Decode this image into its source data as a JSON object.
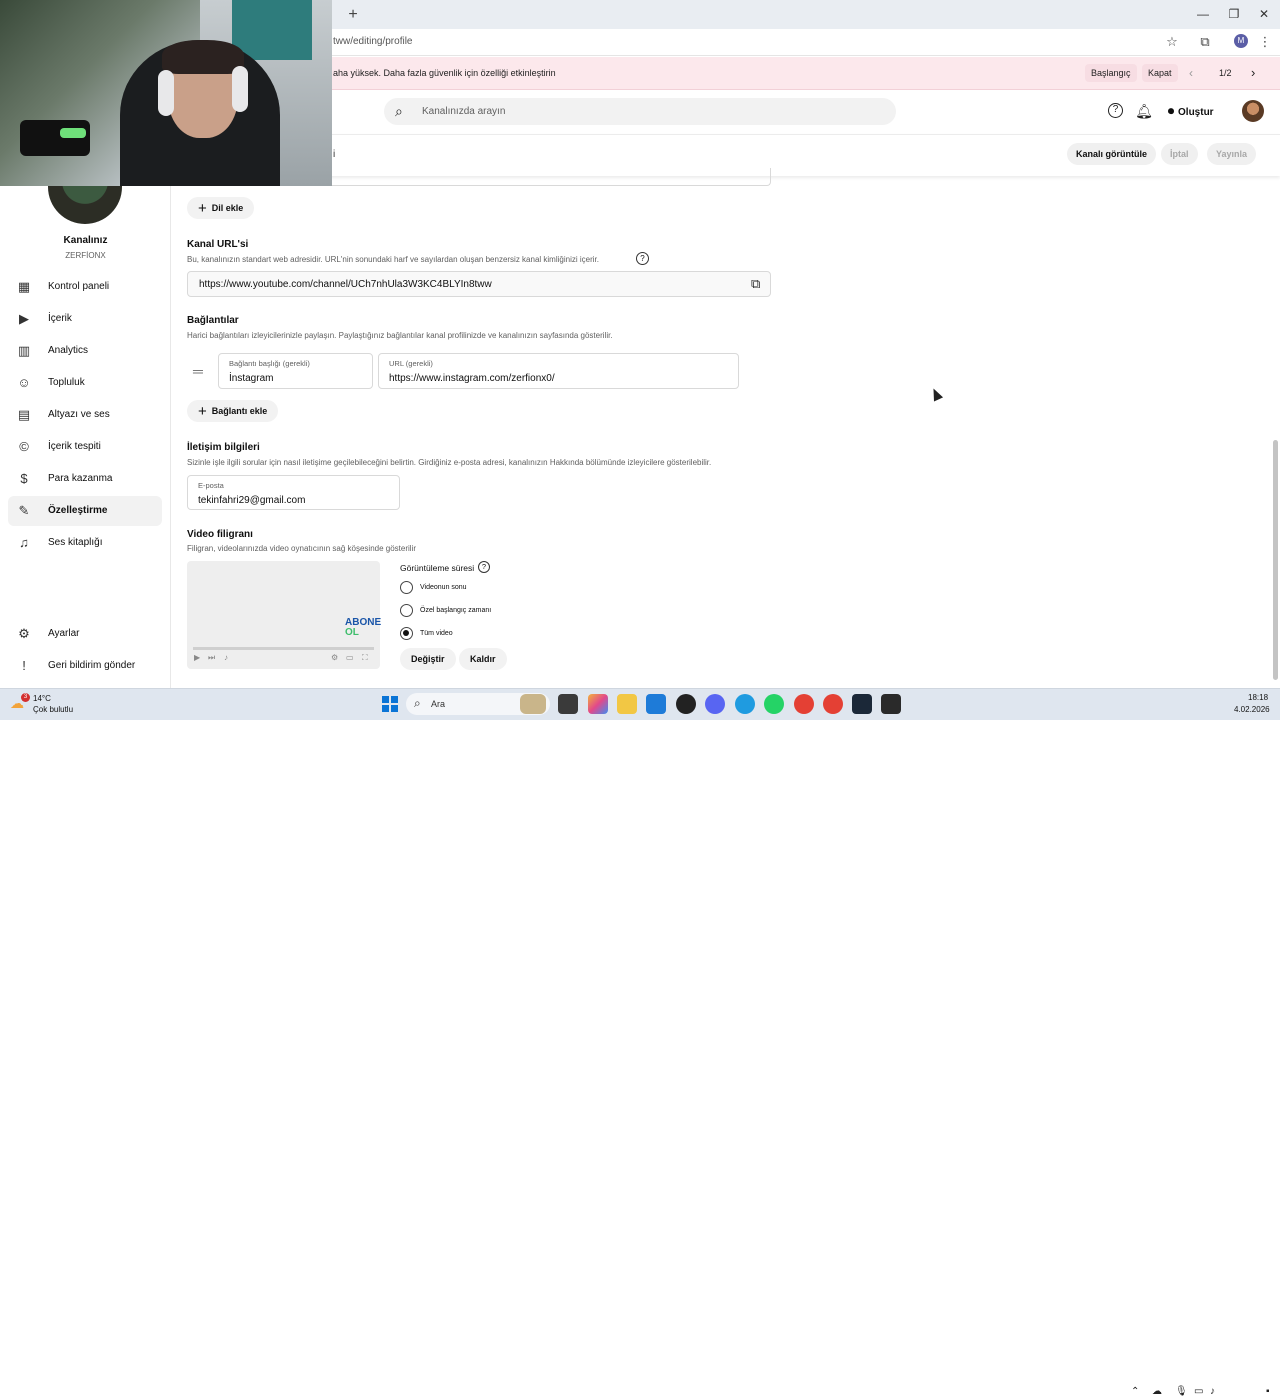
{
  "browser": {
    "url": "tww/editing/profile",
    "new_tab_label": "+",
    "window_controls": {
      "minimize": "—",
      "restore": "❐",
      "close": "✕"
    },
    "profile_initial": "M"
  },
  "infobar": {
    "text": "aha yüksek. Daha fazla güvenlik için özelliği etkinleştirin",
    "start_label": "Başlangıç",
    "close_label": "Kapat",
    "pager": "1/2"
  },
  "header": {
    "search_placeholder": "Kanalınızda arayın",
    "create_label": "Oluştur"
  },
  "subheader": {
    "partial_label": "i",
    "view_channel_label": "Kanalı görüntüle",
    "cancel_label": "İptal",
    "publish_label": "Yayınla"
  },
  "sidebar": {
    "channel_name": "Kanalınız",
    "channel_handle": "ZERFİONX",
    "items": [
      {
        "label": "Kontrol paneli",
        "icon": "dashboard-icon"
      },
      {
        "label": "İçerik",
        "icon": "content-icon"
      },
      {
        "label": "Analytics",
        "icon": "analytics-icon"
      },
      {
        "label": "Topluluk",
        "icon": "community-icon"
      },
      {
        "label": "Altyazı ve ses",
        "icon": "subtitles-icon"
      },
      {
        "label": "İçerik tespiti",
        "icon": "copyright-icon"
      },
      {
        "label": "Para kazanma",
        "icon": "monetization-icon"
      },
      {
        "label": "Özelleştirme",
        "icon": "customization-icon"
      },
      {
        "label": "Ses kitaplığı",
        "icon": "audio-library-icon"
      }
    ],
    "settings_label": "Ayarlar",
    "feedback_label": "Geri bildirim gönder"
  },
  "main": {
    "add_language_label": "Dil ekle",
    "channel_url": {
      "title": "Kanal URL'si",
      "description": "Bu, kanalınızın standart web adresidir. URL'nin sonundaki harf ve sayılardan oluşan benzersiz kanal kimliğinizi içerir.",
      "value": "https://www.youtube.com/channel/UCh7nhUla3W3KC4BLYIn8tww"
    },
    "links": {
      "title": "Bağlantılar",
      "description": "Harici bağlantıları izleyicilerinizle paylaşın. Paylaştığınız bağlantılar kanal profilinizde ve kanalınızın sayfasında gösterilir.",
      "title_field_label": "Bağlantı başlığı (gerekli)",
      "title_field_value": "İnstagram",
      "url_field_label": "URL (gerekli)",
      "url_field_value": "https://www.instagram.com/zerfionx0/",
      "add_link_label": "Bağlantı ekle"
    },
    "contact": {
      "title": "İletişim bilgileri",
      "description": "Sizinle işle ilgili sorular için nasıl iletişime geçilebileceğini belirtin. Girdiğiniz e-posta adresi, kanalınızın Hakkında bölümünde izleyicilere gösterilebilir.",
      "email_label": "E-posta",
      "email_value": "tekinfahri29@gmail.com"
    },
    "watermark": {
      "title": "Video filigranı",
      "description": "Filigran, videolarınızda video oynatıcının sağ köşesinde gösterilir",
      "logo_line1": "ABONE",
      "logo_line2": "OL",
      "display_time_label": "Görüntüleme süresi",
      "options": [
        "Videonun sonu",
        "Özel başlangıç zamanı",
        "Tüm video"
      ],
      "selected_option": "Tüm video",
      "change_label": "Değiştir",
      "remove_label": "Kaldır"
    }
  },
  "taskbar": {
    "weather_temp": "14°C",
    "weather_desc": "Çok bulutlu",
    "weather_badge": "3",
    "search_label": "Ara",
    "time": "18:18",
    "date": "4.02.2026"
  },
  "colors": {
    "infobar_bg": "#fce8ec",
    "accent_blue": "#065fd4",
    "taskbar_bg": "#dfe6ef"
  }
}
